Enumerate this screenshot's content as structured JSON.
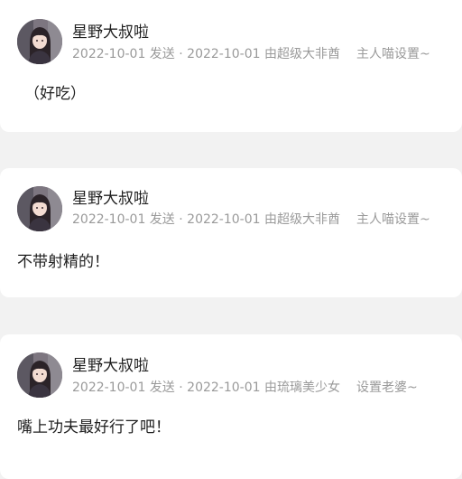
{
  "comments": [
    {
      "username": "星野大叔啦",
      "sent_date": "2022-10-01 发送",
      "by_date": "2022-10-01 由超级大非酋",
      "setting": "主人喵设置~",
      "text": "（好吃）"
    },
    {
      "username": "星野大叔啦",
      "sent_date": "2022-10-01 发送",
      "by_date": "2022-10-01 由超级大非酋",
      "setting": "主人喵设置~",
      "text": "不带射精的！"
    },
    {
      "username": "星野大叔啦",
      "sent_date": "2022-10-01 发送",
      "by_date": "2022-10-01 由琉璃美少女",
      "setting": "设置老婆~",
      "text": "嘴上功夫最好行了吧！"
    }
  ],
  "colors": {
    "page_background": "#f2f2f2",
    "card_background": "#ffffff",
    "text_primary": "#1f1f1f",
    "text_secondary": "#9a9a9a"
  },
  "icons": {
    "avatar": "user-avatar-anime-girl"
  }
}
